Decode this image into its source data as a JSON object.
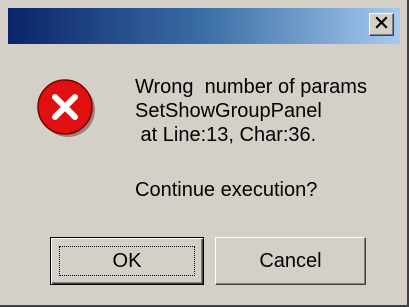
{
  "dialog": {
    "title": "",
    "close_icon": "close-icon",
    "error_icon": "error-icon",
    "message_lines": [
      "Wrong  number of params",
      "SetShowGroupPanel",
      " at Line:13, Char:36."
    ],
    "question": "Continue execution?",
    "buttons": {
      "ok_label": "OK",
      "cancel_label": "Cancel"
    }
  },
  "colors": {
    "face": "#d4d0c8",
    "title_start": "#0a246a",
    "title_end": "#a6caf0",
    "error_red": "#e01010"
  }
}
